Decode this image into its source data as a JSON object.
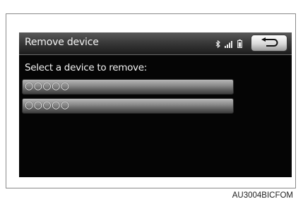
{
  "screen": {
    "title": "Remove device",
    "prompt": "Select a device to remove:",
    "status_icons": [
      "bluetooth-icon",
      "signal-strength-icon",
      "battery-icon"
    ],
    "back_icon": "return-arrow-icon",
    "devices": [
      {
        "label": "○○○○○"
      },
      {
        "label": "○○○○○"
      }
    ]
  },
  "figure_code": "AU3004BICFOM"
}
